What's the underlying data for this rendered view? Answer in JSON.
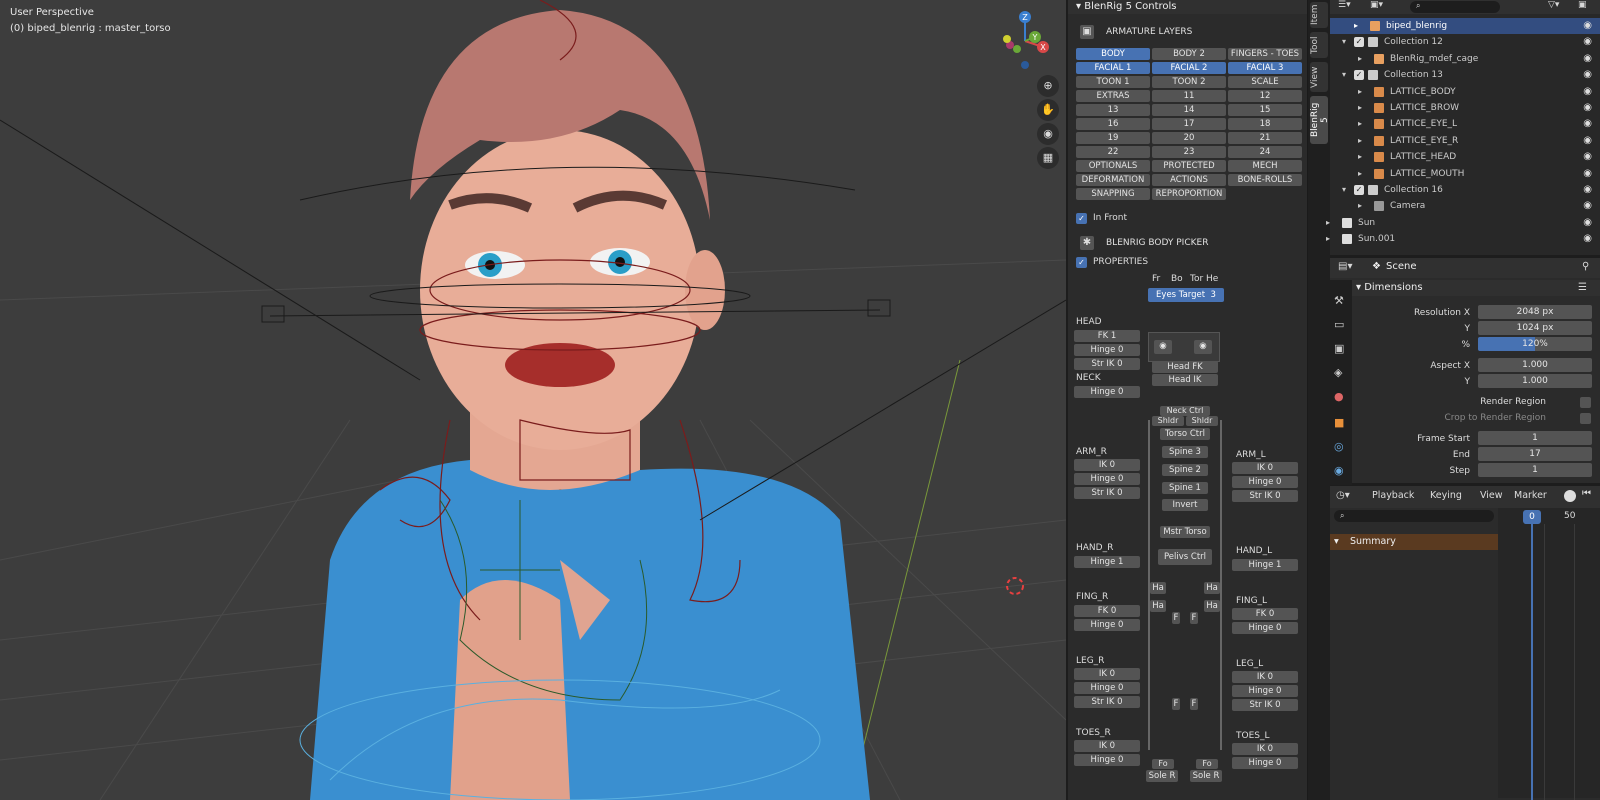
{
  "viewport": {
    "mode": "User Perspective",
    "object": "(0) biped_blenrig : master_torso",
    "axes": {
      "x": "X",
      "y": "Y",
      "z": "Z"
    },
    "tools": [
      "zoom-icon",
      "hand-icon",
      "camera-icon",
      "grid-icon"
    ]
  },
  "npanel": {
    "title": "BlenRig 5 Controls",
    "tabs": [
      "Item",
      "Tool",
      "View",
      "BlenRig 5"
    ],
    "armature_layers_title": "ARMATURE LAYERS",
    "layers": [
      {
        "label": "BODY",
        "on": true
      },
      {
        "label": "BODY 2",
        "on": false
      },
      {
        "label": "FINGERS - TOES",
        "on": false
      },
      {
        "label": "FACIAL 1",
        "on": true
      },
      {
        "label": "FACIAL 2",
        "on": true
      },
      {
        "label": "FACIAL 3",
        "on": true
      },
      {
        "label": "TOON 1",
        "on": false
      },
      {
        "label": "TOON 2",
        "on": false
      },
      {
        "label": "SCALE",
        "on": false
      },
      {
        "label": "EXTRAS",
        "on": false
      },
      {
        "label": "11",
        "on": false
      },
      {
        "label": "12",
        "on": false
      },
      {
        "label": "13",
        "on": false
      },
      {
        "label": "14",
        "on": false
      },
      {
        "label": "15",
        "on": false
      },
      {
        "label": "16",
        "on": false
      },
      {
        "label": "17",
        "on": false
      },
      {
        "label": "18",
        "on": false
      },
      {
        "label": "19",
        "on": false
      },
      {
        "label": "20",
        "on": false
      },
      {
        "label": "21",
        "on": false
      },
      {
        "label": "22",
        "on": false
      },
      {
        "label": "23",
        "on": false
      },
      {
        "label": "24",
        "on": false
      },
      {
        "label": "OPTIONALS",
        "on": false
      },
      {
        "label": "PROTECTED",
        "on": false
      },
      {
        "label": "MECH",
        "on": false
      },
      {
        "label": "DEFORMATION",
        "on": false
      },
      {
        "label": "ACTIONS",
        "on": false
      },
      {
        "label": "BONE-ROLLS",
        "on": false
      },
      {
        "label": "SNAPPING",
        "on": false
      },
      {
        "label": "REPROPORTION",
        "on": false
      }
    ],
    "in_front": "In Front",
    "body_picker_title": "BLENRIG BODY PICKER",
    "properties": "PROPERTIES",
    "view_toggles": [
      "Fr",
      "Bo",
      "Tor He"
    ],
    "eyes_target": "Eyes Target",
    "eyes_target_num": "3",
    "picker": {
      "head": "HEAD",
      "head_fk": "FK 1",
      "head_hinge": "Hinge 0",
      "head_strik": "Str IK 0",
      "head_fk_btn": "Head FK",
      "head_ik_btn": "Head IK",
      "neck": "NECK",
      "neck_hinge": "Hinge 0",
      "neck_ctrl": "Neck Ctrl",
      "shldr_l": "Shldr",
      "shldr_r": "Shldr",
      "torso_ctrl": "Torso Ctrl",
      "spine3": "Spine 3",
      "spine2": "Spine 2",
      "spine1": "Spine 1",
      "invert": "Invert",
      "mstr_torso": "Mstr Torso",
      "pelvis_ctrl": "Pelivs Ctrl",
      "arm_r": "ARM_R",
      "arm_r_ik": "IK 0",
      "arm_r_hinge": "Hinge 0",
      "arm_r_strik": "Str IK 0",
      "arm_l": "ARM_L",
      "arm_l_ik": "IK 0",
      "arm_l_hinge": "Hinge 0",
      "arm_l_strik": "Str IK 0",
      "hand_r": "HAND_R",
      "hand_r_hinge": "Hinge 1",
      "hand_l": "HAND_L",
      "hand_l_hinge": "Hinge 1",
      "fing_r": "FING_R",
      "fing_r_fk": "FK 0",
      "fing_r_hinge": "Hinge 0",
      "fing_l": "FING_L",
      "fing_l_fk": "FK 0",
      "fing_l_hinge": "Hinge 0",
      "leg_r": "LEG_R",
      "leg_r_ik": "IK 0",
      "leg_r_hinge": "Hinge 0",
      "leg_r_strik": "Str IK 0",
      "leg_l": "LEG_L",
      "leg_l_ik": "IK 0",
      "leg_l_hinge": "Hinge 0",
      "leg_l_strik": "Str IK 0",
      "toes_r": "TOES_R",
      "toes_r_ik": "IK 0",
      "toes_r_hinge": "Hinge 0",
      "toes_l": "TOES_L",
      "toes_l_ik": "IK 0",
      "toes_l_hinge": "Hinge 0",
      "sole_r": "Sole R",
      "sole_l": "Sole R",
      "ha": "Ha",
      "f": "F",
      "fo": "Fo"
    }
  },
  "outliner": {
    "rows": [
      {
        "label": "biped_blenrig",
        "indent": 40,
        "selected": true,
        "color": "#e8a060",
        "check": false
      },
      {
        "label": "Collection 12",
        "indent": 28,
        "selected": false,
        "color": "#ccc",
        "check": true
      },
      {
        "label": "BlenRig_mdef_cage",
        "indent": 44,
        "selected": false,
        "color": "#e8a060",
        "check": false
      },
      {
        "label": "Collection 13",
        "indent": 28,
        "selected": false,
        "color": "#ccc",
        "check": true
      },
      {
        "label": "LATTICE_BODY",
        "indent": 44,
        "selected": false,
        "color": "#d98a4a",
        "check": false
      },
      {
        "label": "LATTICE_BROW",
        "indent": 44,
        "selected": false,
        "color": "#d98a4a",
        "check": false
      },
      {
        "label": "LATTICE_EYE_L",
        "indent": 44,
        "selected": false,
        "color": "#d98a4a",
        "check": false
      },
      {
        "label": "LATTICE_EYE_R",
        "indent": 44,
        "selected": false,
        "color": "#d98a4a",
        "check": false
      },
      {
        "label": "LATTICE_HEAD",
        "indent": 44,
        "selected": false,
        "color": "#d98a4a",
        "check": false
      },
      {
        "label": "LATTICE_MOUTH",
        "indent": 44,
        "selected": false,
        "color": "#d98a4a",
        "check": false
      },
      {
        "label": "Collection 16",
        "indent": 28,
        "selected": false,
        "color": "#ccc",
        "check": true
      },
      {
        "label": "Camera",
        "indent": 44,
        "selected": false,
        "color": "#999",
        "check": false
      },
      {
        "label": "Sun",
        "indent": 12,
        "selected": false,
        "color": "#ddd",
        "check": false
      },
      {
        "label": "Sun.001",
        "indent": 12,
        "selected": false,
        "color": "#ddd",
        "check": false
      }
    ]
  },
  "properties": {
    "scene": "Scene",
    "dimensions_title": "Dimensions",
    "resolution_x_label": "Resolution X",
    "resolution_x": "2048 px",
    "resolution_y_label": "Y",
    "resolution_y": "1024 px",
    "percent_label": "%",
    "percent": "120%",
    "aspect_x_label": "Aspect X",
    "aspect_x": "1.000",
    "aspect_y_label": "Y",
    "aspect_y": "1.000",
    "render_region": "Render Region",
    "crop_region": "Crop to Render Region",
    "frame_start_label": "Frame Start",
    "frame_start": "1",
    "end_label": "End",
    "end": "17",
    "step_label": "Step",
    "step": "1"
  },
  "timeline": {
    "menus": [
      "Playback",
      "Keying",
      "View",
      "Marker"
    ],
    "current_frame": "0",
    "frame_mark": "50",
    "summary": "Summary"
  },
  "colors": {
    "accent": "#4772b3",
    "selected_row": "#334d80",
    "summary": "#5a3a20"
  }
}
